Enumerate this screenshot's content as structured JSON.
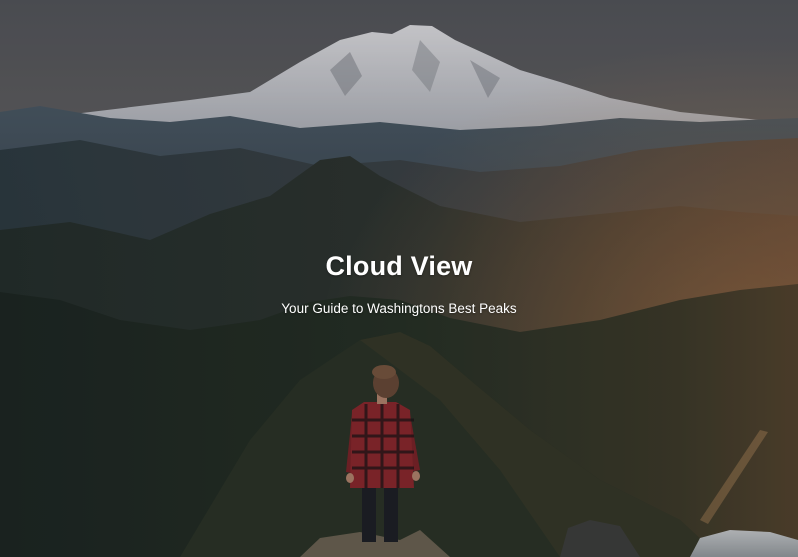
{
  "hero": {
    "title": "Cloud View",
    "subtitle": "Your Guide to Washingtons Best Peaks",
    "background_image": "mountain-hiker-photo"
  },
  "colors": {
    "text": "#ffffff",
    "sky_top": "#5b5d62",
    "sky_horizon": "#8a7564",
    "forest_dark": "#1f2a22",
    "shirt_red": "#9a2a2e"
  }
}
